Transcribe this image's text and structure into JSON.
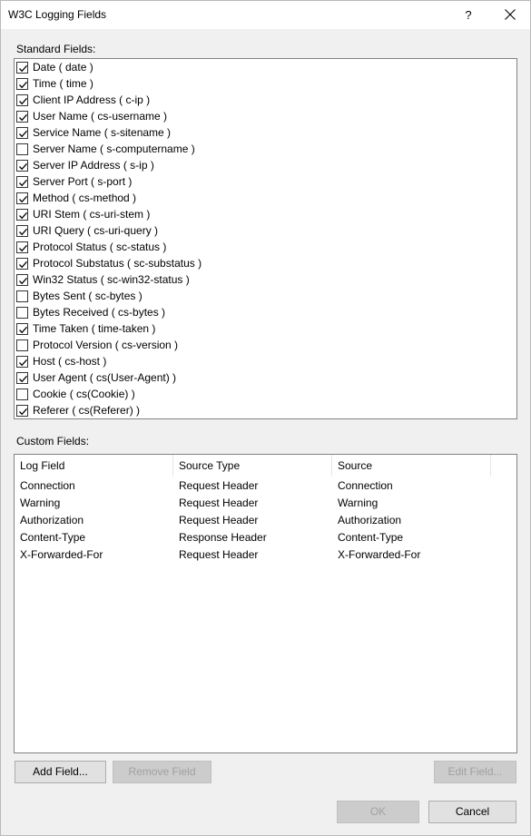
{
  "window": {
    "title": "W3C Logging Fields",
    "help_label": "?"
  },
  "standard": {
    "label": "Standard Fields:",
    "fields": [
      {
        "label": "Date ( date )",
        "checked": true
      },
      {
        "label": "Time ( time )",
        "checked": true
      },
      {
        "label": "Client IP Address ( c-ip )",
        "checked": true
      },
      {
        "label": "User Name ( cs-username )",
        "checked": true
      },
      {
        "label": "Service Name ( s-sitename )",
        "checked": true
      },
      {
        "label": "Server Name ( s-computername )",
        "checked": false
      },
      {
        "label": "Server IP Address ( s-ip )",
        "checked": true
      },
      {
        "label": "Server Port ( s-port )",
        "checked": true
      },
      {
        "label": "Method ( cs-method )",
        "checked": true
      },
      {
        "label": "URI Stem ( cs-uri-stem )",
        "checked": true
      },
      {
        "label": "URI Query ( cs-uri-query )",
        "checked": true
      },
      {
        "label": "Protocol Status ( sc-status )",
        "checked": true
      },
      {
        "label": "Protocol Substatus ( sc-substatus )",
        "checked": true
      },
      {
        "label": "Win32 Status ( sc-win32-status )",
        "checked": true
      },
      {
        "label": "Bytes Sent ( sc-bytes )",
        "checked": false
      },
      {
        "label": "Bytes Received ( cs-bytes )",
        "checked": false
      },
      {
        "label": "Time Taken ( time-taken )",
        "checked": true
      },
      {
        "label": "Protocol Version ( cs-version )",
        "checked": false
      },
      {
        "label": "Host ( cs-host )",
        "checked": true
      },
      {
        "label": "User Agent ( cs(User-Agent) )",
        "checked": true
      },
      {
        "label": "Cookie ( cs(Cookie) )",
        "checked": false
      },
      {
        "label": "Referer ( cs(Referer) )",
        "checked": true
      }
    ]
  },
  "custom": {
    "label": "Custom Fields:",
    "columns": [
      "Log Field",
      "Source Type",
      "Source"
    ],
    "rows": [
      [
        "Connection",
        "Request Header",
        "Connection"
      ],
      [
        "Warning",
        "Request Header",
        "Warning"
      ],
      [
        "Authorization",
        "Request Header",
        "Authorization"
      ],
      [
        "Content-Type",
        "Response Header",
        "Content-Type"
      ],
      [
        "X-Forwarded-For",
        "Request Header",
        "X-Forwarded-For"
      ]
    ]
  },
  "buttons": {
    "add": "Add Field...",
    "remove": "Remove Field",
    "edit": "Edit Field...",
    "ok": "OK",
    "cancel": "Cancel"
  }
}
